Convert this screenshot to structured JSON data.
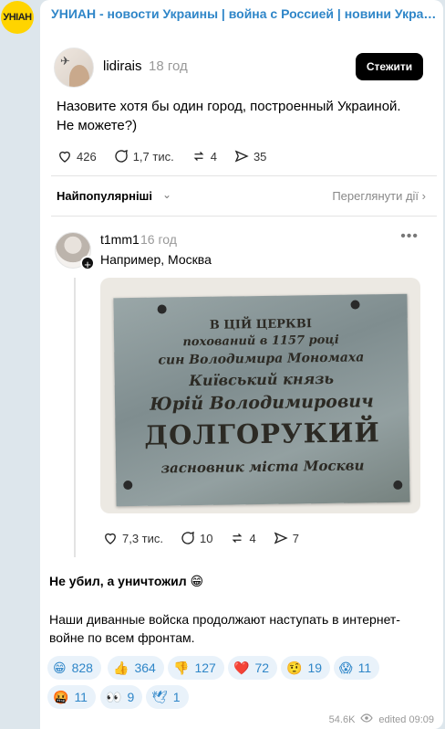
{
  "channel": {
    "name": "УНИАН - новости Украины | война с Россией | новини Україні...",
    "avatar_text": "УНІАН"
  },
  "post": {
    "username": "lidirais",
    "time": "18 год",
    "follow_label": "Стежити",
    "text": "Назовите хотя бы один город, построенный Украиной. Не можете?)",
    "likes": "426",
    "comments": "1,7 тис.",
    "reposts": "4",
    "shares": "35"
  },
  "sort": {
    "label": "Найпопулярніші",
    "view_activity": "Переглянути дії"
  },
  "reply": {
    "username": "t1mm1",
    "time": "16 год",
    "text": "Например, Москва",
    "plaque_lines": [
      "В ЦІЙ ЦЕРКВІ",
      "похований в 1157 році",
      "син Володимира Мономаха",
      "Київський князь",
      "Юрій Володимирович",
      "ДОЛГОРУКИЙ",
      "засновник міста Москви"
    ],
    "likes": "7,3 тис.",
    "comments": "10",
    "reposts": "4",
    "shares": "7"
  },
  "message": {
    "headline": "Не убил, а уничтожил 😁",
    "body": "Наши диванные войска продолжают наступать в интернет-войне по всем фронтам."
  },
  "reactions": [
    {
      "emoji": "😁",
      "count": "828"
    },
    {
      "emoji": "👍",
      "count": "364"
    },
    {
      "emoji": "👎",
      "count": "127"
    },
    {
      "emoji": "❤️",
      "count": "72"
    },
    {
      "emoji": "🤨",
      "count": "19"
    },
    {
      "emoji": "😱",
      "count": "11"
    },
    {
      "emoji": "🤬",
      "count": "11"
    },
    {
      "emoji": "👀",
      "count": "9"
    },
    {
      "emoji": "🕊",
      "count": "1"
    }
  ],
  "footer": {
    "views": "54.6K",
    "edited_label": "edited",
    "time": "09:09"
  }
}
